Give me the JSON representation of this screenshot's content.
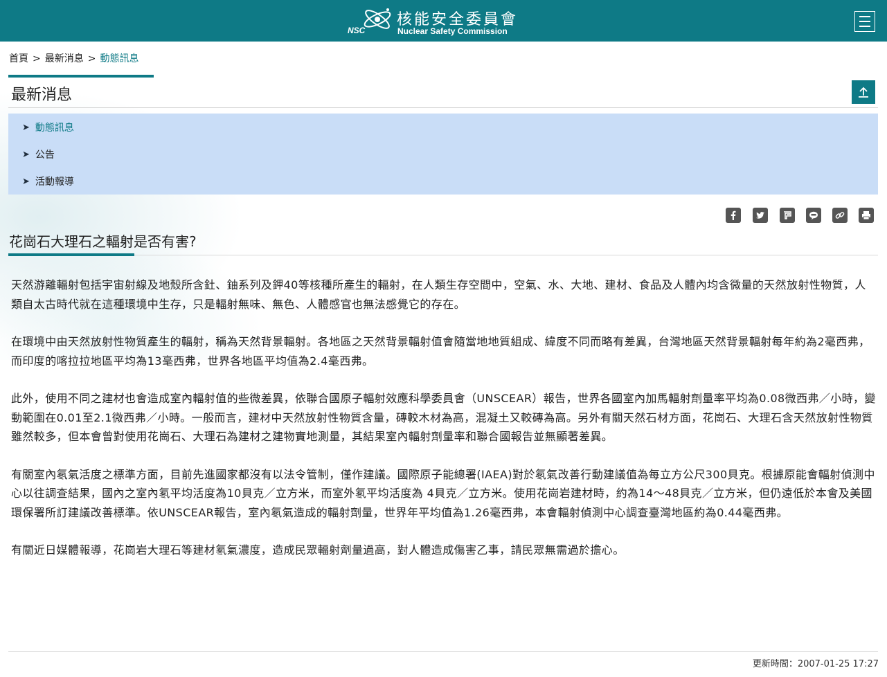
{
  "header": {
    "logo_abbr": "NSC",
    "logo_cn": "核能安全委員會",
    "logo_en": "Nuclear Safety Commission",
    "menu_icon": "hamburger-menu-icon",
    "bg_color": "#0e7a86"
  },
  "breadcrumb": {
    "items": [
      "首頁",
      "最新消息",
      "動態訊息"
    ],
    "separator": ">"
  },
  "section": {
    "title": "最新消息",
    "toggle_icon": "collapse-up-icon"
  },
  "subnav": {
    "items": [
      {
        "label": "動態訊息",
        "active": true
      },
      {
        "label": "公告",
        "active": false
      },
      {
        "label": "活動報導",
        "active": false
      }
    ],
    "bg_color": "#c9ddf7"
  },
  "share_icons": [
    "facebook-icon",
    "twitter-icon",
    "plurk-icon",
    "line-icon",
    "link-icon",
    "print-icon"
  ],
  "article": {
    "title": "花崗石大理石之輻射是否有害?",
    "paragraphs": [
      "天然游離輻射包括宇宙射線及地殼所含釷、鈾系列及鉀40等核種所產生的輻射，在人類生存空間中，空氣、水、大地、建材、食品及人體內均含微量的天然放射性物質，人類自太古時代就在這種環境中生存，只是輻射無味、無色、人體感官也無法感覺它的存在。",
      "在環境中由天然放射性物質產生的輻射，稱為天然背景輻射。各地區之天然背景輻射值會隨當地地質組成、緯度不同而略有差異，台灣地區天然背景輻射每年約為2毫西弗，而印度的喀拉拉地區平均為13毫西弗，世界各地區平均值為2.4毫西弗。",
      "此外，使用不同之建材也會造成室內輻射值的些微差異，依聯合國原子輻射效應科學委員會（UNSCEAR）報告，世界各國室內加馬輻射劑量率平均為0.08微西弗／小時，變動範圍在0.01至2.1微西弗／小時。一般而言，建材中天然放射性物質含量，磚較木材為高，混凝土又較磚為高。另外有關天然石材方面，花崗石、大理石含天然放射性物質雖然較多，但本會曾對使用花崗石、大理石為建材之建物實地測量，其結果室內輻射劑量率和聯合國報告並無顯著差異。",
      "有關室內氡氣活度之標準方面，目前先進國家都沒有以法令管制，僅作建議。國際原子能總署(IAEA)對於氡氣改善行動建議值為每立方公尺300貝克。根據原能會輻射偵測中心以往調查結果，國內之室內氡平均活度為10貝克／立方米，而室外氡平均活度為 4貝克／立方米。使用花崗岩建材時，約為14～48貝克／立方米，但仍遠低於本會及美國環保署所訂建議改善標準。依UNSCEAR報告，室內氡氣造成的輻射劑量，世界年平均值為1.26毫西弗，本會輻射偵測中心調查臺灣地區約為0.44毫西弗。",
      "有關近日媒體報導，花崗岩大理石等建材氡氣濃度，造成民眾輻射劑量過高，對人體造成傷害乙事，請民眾無需過於擔心。"
    ]
  },
  "footer": {
    "update_time": "更新時間：2007-01-25 17:27"
  }
}
